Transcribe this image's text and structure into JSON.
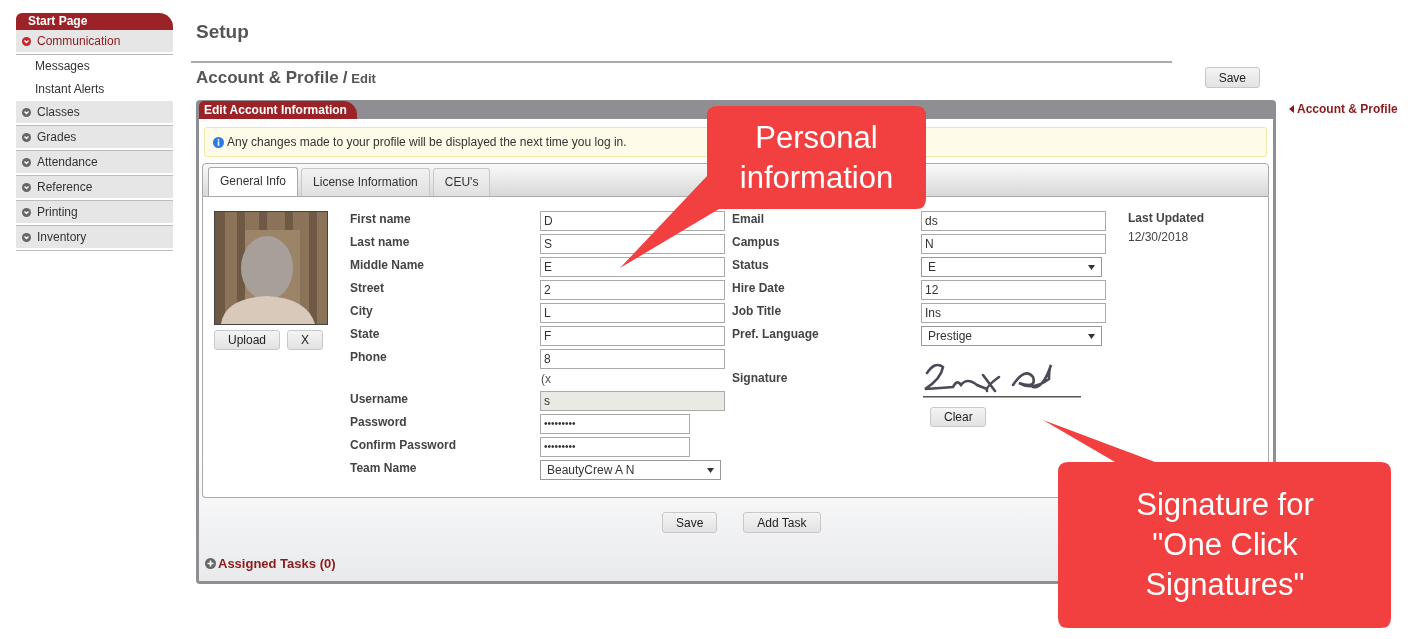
{
  "sidebar": {
    "header": "Start Page",
    "items": [
      {
        "label": "Communication",
        "expanded": true,
        "children": [
          {
            "label": "Messages"
          },
          {
            "label": "Instant Alerts"
          }
        ]
      },
      {
        "label": "Classes",
        "expanded": false
      },
      {
        "label": "Grades",
        "expanded": false
      },
      {
        "label": "Attendance",
        "expanded": false
      },
      {
        "label": "Reference",
        "expanded": false
      },
      {
        "label": "Printing",
        "expanded": false
      },
      {
        "label": "Inventory",
        "expanded": false
      }
    ]
  },
  "page": {
    "title": "Setup",
    "heading": "Account & Profile",
    "separator": "/",
    "subheading": "Edit",
    "save_button": "Save",
    "back_link": "Account & Profile"
  },
  "panel": {
    "title": "Edit Account Information",
    "notice": "Any changes made to your profile will be displayed the next time you log in.",
    "tabs": [
      {
        "label": "General Info",
        "selected": true
      },
      {
        "label": "License Information",
        "selected": false
      },
      {
        "label": "CEU's",
        "selected": false
      }
    ],
    "photo_buttons": [
      "Upload",
      "X"
    ],
    "left_fields": [
      {
        "label": "First name",
        "kind": "text",
        "value": "D"
      },
      {
        "label": "Last name",
        "kind": "text",
        "value": "S"
      },
      {
        "label": "Middle Name",
        "kind": "text",
        "value": "E"
      },
      {
        "label": "Street",
        "kind": "text",
        "value": "2"
      },
      {
        "label": "City",
        "kind": "text",
        "value": "L"
      },
      {
        "label": "State",
        "kind": "text",
        "value": "F"
      },
      {
        "label": "Phone",
        "kind": "text",
        "value": "8",
        "note": "(x"
      },
      {
        "label": "Username",
        "kind": "disabled",
        "value": "s"
      },
      {
        "label": "Password",
        "kind": "password",
        "value": "•••••••••"
      },
      {
        "label": "Confirm Password",
        "kind": "password",
        "value": "•••••••••"
      },
      {
        "label": "Team Name",
        "kind": "select",
        "value": "BeautyCrew A N"
      }
    ],
    "right_fields": [
      {
        "label": "Email",
        "kind": "text",
        "value": "ds"
      },
      {
        "label": "Campus",
        "kind": "text",
        "value": "N"
      },
      {
        "label": "Status",
        "kind": "select",
        "value": "E"
      },
      {
        "label": "Hire Date",
        "kind": "text",
        "value": "12"
      },
      {
        "label": "Job Title",
        "kind": "text",
        "value": "Ins"
      },
      {
        "label": "Pref. Language",
        "kind": "select",
        "value": "Prestige"
      },
      {
        "label": "Signature",
        "kind": "signature",
        "button": "Clear"
      }
    ],
    "last_updated": {
      "label": "Last Updated",
      "value": "12/30/2018"
    },
    "buttons": [
      "Save",
      "Add Task"
    ],
    "assigned_tasks": "Assigned Tasks (0)"
  },
  "callouts": [
    {
      "kind": "top",
      "text": "Personal information"
    },
    {
      "kind": "bottom",
      "text": "Signature for \"One Click Signatures\""
    }
  ]
}
